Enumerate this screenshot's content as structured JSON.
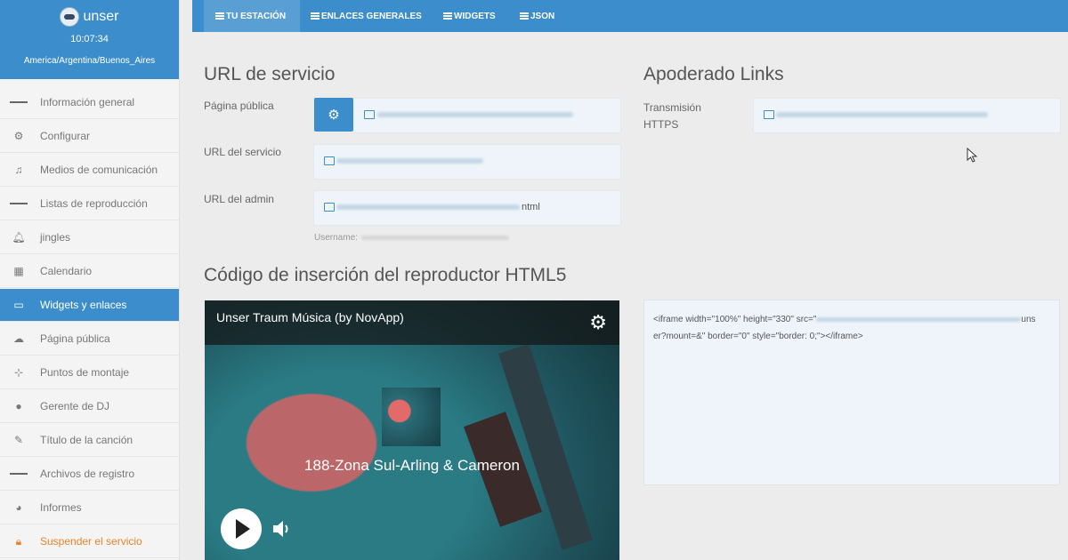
{
  "brand": {
    "name": "unser",
    "time": "10:07:34",
    "timezone": "America/Argentina/Buenos_Aires"
  },
  "sidebar": {
    "items": [
      {
        "label": "Información general",
        "icon": "menu-icon"
      },
      {
        "label": "Configurar",
        "icon": "gears-icon"
      },
      {
        "label": "Medios de comunicación",
        "icon": "music-icon"
      },
      {
        "label": "Listas de reproducción",
        "icon": "list-icon"
      },
      {
        "label": "jingles",
        "icon": "bell-icon"
      },
      {
        "label": "Calendario",
        "icon": "calendar-icon"
      },
      {
        "label": "Widgets y enlaces",
        "icon": "monitor-icon",
        "active": true
      },
      {
        "label": "Página pública",
        "icon": "cloud-icon"
      },
      {
        "label": "Puntos de montaje",
        "icon": "sitemap-icon"
      },
      {
        "label": "Gerente de DJ",
        "icon": "user-icon"
      },
      {
        "label": "Título de la canción",
        "icon": "edit-icon"
      },
      {
        "label": "Archivos de registro",
        "icon": "list-icon"
      },
      {
        "label": "Informes",
        "icon": "pie-chart-icon"
      },
      {
        "label": "Suspender el servicio",
        "icon": "lock-icon",
        "warning": true
      }
    ]
  },
  "tabs": [
    {
      "label": "TU ESTACIÓN",
      "active": true
    },
    {
      "label": "ENLACES GENERALES"
    },
    {
      "label": "WIDGETS"
    },
    {
      "label": "JSON"
    }
  ],
  "service": {
    "title": "URL de servicio",
    "public_page_label": "Página pública",
    "service_url_label": "URL del servicio",
    "admin_url_label": "URL del admin",
    "admin_url_suffix": "ntml",
    "username_label": "Username:"
  },
  "proxy": {
    "title": "Apoderado Links",
    "https_label_line1": "Transmisión",
    "https_label_line2": "HTTPS"
  },
  "embed": {
    "title": "Código de inserción del reproductor HTML5",
    "code_part1": "<iframe width=\"100%\" height=\"330\" src=\"",
    "code_part2": "uns",
    "code_part3": "er?mount=&\" border=\"0\" style=\"border: 0;\"></iframe>"
  },
  "player": {
    "title": "Unser Traum Música (by NovApp)",
    "song": "188-Zona Sul-Arling & Cameron"
  },
  "colors": {
    "primary": "#3c8dcb",
    "warning": "#e8832a"
  }
}
